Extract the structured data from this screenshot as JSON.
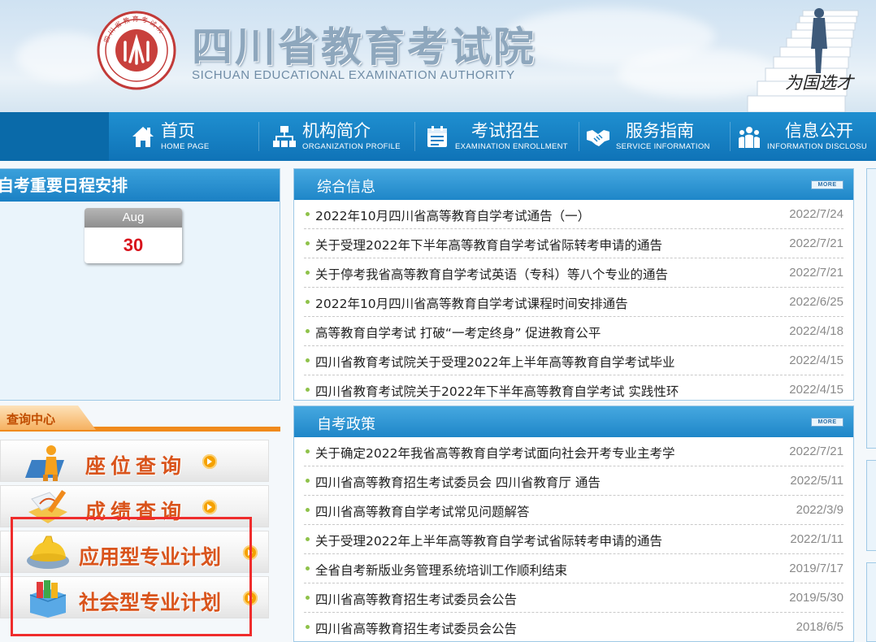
{
  "header": {
    "title": "四川省教育考试院",
    "subtitle": "SICHUAN EDUCATIONAL EXAMINATION AUTHORITY",
    "slogan": "为国选才",
    "seal_text": "四川省教育考试院"
  },
  "nav": {
    "items": [
      {
        "zh": "首页",
        "en": "HOME  PAGE",
        "icon": "home-icon"
      },
      {
        "zh": "机构简介",
        "en": "ORGANIZATION PROFILE",
        "icon": "org-chart-icon"
      },
      {
        "zh": "考试招生",
        "en": "EXAMINATION ENROLLMENT",
        "icon": "calendar-icon"
      },
      {
        "zh": "服务指南",
        "en": "SERVICE  INFORMATION",
        "icon": "handshake-icon"
      },
      {
        "zh": "信息公开",
        "en": "INFORMATION DISCLOSU",
        "icon": "people-icon"
      }
    ]
  },
  "schedule": {
    "title": "自考重要日程安排",
    "month": "Aug",
    "day": "30"
  },
  "query": {
    "title": "查询中心",
    "buttons": [
      {
        "label": "座位查询",
        "icon": "seat-person-icon"
      },
      {
        "label": "成绩查询",
        "icon": "pencil-paper-icon"
      },
      {
        "label": "应用型专业计划",
        "icon": "helmet-icon"
      },
      {
        "label": "社会型专业计划",
        "icon": "books-box-icon"
      }
    ]
  },
  "news_general": {
    "title": "综合信息",
    "more": "MORE",
    "items": [
      {
        "title": "2022年10月四川省高等教育自学考试通告（一）",
        "date": "2022/7/24"
      },
      {
        "title": "关于受理2022年下半年高等教育自学考试省际转考申请的通告",
        "date": "2022/7/21"
      },
      {
        "title": "关于停考我省高等教育自学考试英语（专科）等八个专业的通告",
        "date": "2022/7/21"
      },
      {
        "title": "2022年10月四川省高等教育自学考试课程时间安排通告",
        "date": "2022/6/25"
      },
      {
        "title": "高等教育自学考试 打破“一考定终身” 促进教育公平",
        "date": "2022/4/18"
      },
      {
        "title": "四川省教育考试院关于受理2022年上半年高等教育自学考试毕业",
        "date": "2022/4/15"
      },
      {
        "title": "四川省教育考试院关于2022年下半年高等教育自学考试 实践性环",
        "date": "2022/4/15"
      }
    ]
  },
  "news_policy": {
    "title": "自考政策",
    "more": "MORE",
    "items": [
      {
        "title": "关于确定2022年我省高等教育自学考试面向社会开考专业主考学",
        "date": "2022/7/21"
      },
      {
        "title": "四川省高等教育招生考试委员会 四川省教育厅 通告",
        "date": "2022/5/11"
      },
      {
        "title": "四川省高等教育自学考试常见问题解答",
        "date": "2022/3/9"
      },
      {
        "title": "关于受理2022年上半年高等教育自学考试省际转考申请的通告",
        "date": "2022/1/11"
      },
      {
        "title": "全省自考新版业务管理系统培训工作顺利结束",
        "date": "2019/7/17"
      },
      {
        "title": "四川省高等教育招生考试委员会公告",
        "date": "2019/5/30"
      },
      {
        "title": "四川省高等教育招生考试委员会公告",
        "date": "2018/6/5"
      }
    ]
  },
  "colors": {
    "nav_blue": "#1680c6",
    "accent_orange": "#f08a1c",
    "highlight_red": "#ef2c2c",
    "date_red": "#d8131c"
  }
}
